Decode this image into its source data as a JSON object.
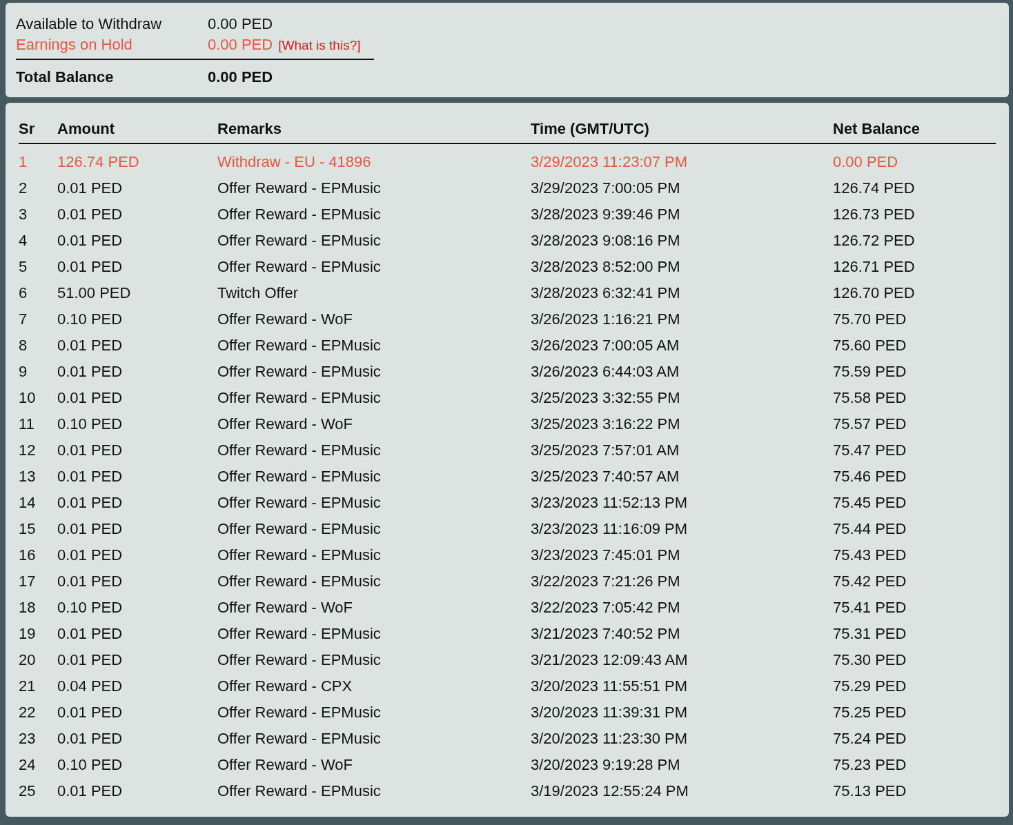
{
  "balance": {
    "rows": [
      {
        "kind": "available",
        "label": "Available to Withdraw",
        "value": "0.00 PED"
      },
      {
        "kind": "hold",
        "label": "Earnings on Hold",
        "value": "0.00 PED",
        "link": "[What is this?]"
      },
      {
        "kind": "total",
        "label": "Total Balance",
        "value": "0.00 PED"
      }
    ]
  },
  "table": {
    "columns": [
      "Sr",
      "Amount",
      "Remarks",
      "Time (GMT/UTC)",
      "Net Balance"
    ],
    "rows": [
      {
        "kind": "withdrawal",
        "cells": [
          "1",
          "126.74 PED",
          "Withdraw - EU - 41896",
          "3/29/2023 11:23:07 PM",
          "0.00 PED"
        ]
      },
      {
        "kind": "credit",
        "cells": [
          "2",
          "0.01 PED",
          "Offer Reward - EPMusic",
          "3/29/2023 7:00:05 PM",
          "126.74 PED"
        ]
      },
      {
        "kind": "credit",
        "cells": [
          "3",
          "0.01 PED",
          "Offer Reward - EPMusic",
          "3/28/2023 9:39:46 PM",
          "126.73 PED"
        ]
      },
      {
        "kind": "credit",
        "cells": [
          "4",
          "0.01 PED",
          "Offer Reward - EPMusic",
          "3/28/2023 9:08:16 PM",
          "126.72 PED"
        ]
      },
      {
        "kind": "credit",
        "cells": [
          "5",
          "0.01 PED",
          "Offer Reward - EPMusic",
          "3/28/2023 8:52:00 PM",
          "126.71 PED"
        ]
      },
      {
        "kind": "credit",
        "cells": [
          "6",
          "51.00 PED",
          "Twitch Offer",
          "3/28/2023 6:32:41 PM",
          "126.70 PED"
        ]
      },
      {
        "kind": "credit",
        "cells": [
          "7",
          "0.10 PED",
          "Offer Reward - WoF",
          "3/26/2023 1:16:21 PM",
          "75.70 PED"
        ]
      },
      {
        "kind": "credit",
        "cells": [
          "8",
          "0.01 PED",
          "Offer Reward - EPMusic",
          "3/26/2023 7:00:05 AM",
          "75.60 PED"
        ]
      },
      {
        "kind": "credit",
        "cells": [
          "9",
          "0.01 PED",
          "Offer Reward - EPMusic",
          "3/26/2023 6:44:03 AM",
          "75.59 PED"
        ]
      },
      {
        "kind": "credit",
        "cells": [
          "10",
          "0.01 PED",
          "Offer Reward - EPMusic",
          "3/25/2023 3:32:55 PM",
          "75.58 PED"
        ]
      },
      {
        "kind": "credit",
        "cells": [
          "11",
          "0.10 PED",
          "Offer Reward - WoF",
          "3/25/2023 3:16:22 PM",
          "75.57 PED"
        ]
      },
      {
        "kind": "credit",
        "cells": [
          "12",
          "0.01 PED",
          "Offer Reward - EPMusic",
          "3/25/2023 7:57:01 AM",
          "75.47 PED"
        ]
      },
      {
        "kind": "credit",
        "cells": [
          "13",
          "0.01 PED",
          "Offer Reward - EPMusic",
          "3/25/2023 7:40:57 AM",
          "75.46 PED"
        ]
      },
      {
        "kind": "credit",
        "cells": [
          "14",
          "0.01 PED",
          "Offer Reward - EPMusic",
          "3/23/2023 11:52:13 PM",
          "75.45 PED"
        ]
      },
      {
        "kind": "credit",
        "cells": [
          "15",
          "0.01 PED",
          "Offer Reward - EPMusic",
          "3/23/2023 11:16:09 PM",
          "75.44 PED"
        ]
      },
      {
        "kind": "credit",
        "cells": [
          "16",
          "0.01 PED",
          "Offer Reward - EPMusic",
          "3/23/2023 7:45:01 PM",
          "75.43 PED"
        ]
      },
      {
        "kind": "credit",
        "cells": [
          "17",
          "0.01 PED",
          "Offer Reward - EPMusic",
          "3/22/2023 7:21:26 PM",
          "75.42 PED"
        ]
      },
      {
        "kind": "credit",
        "cells": [
          "18",
          "0.10 PED",
          "Offer Reward - WoF",
          "3/22/2023 7:05:42 PM",
          "75.41 PED"
        ]
      },
      {
        "kind": "credit",
        "cells": [
          "19",
          "0.01 PED",
          "Offer Reward - EPMusic",
          "3/21/2023 7:40:52 PM",
          "75.31 PED"
        ]
      },
      {
        "kind": "credit",
        "cells": [
          "20",
          "0.01 PED",
          "Offer Reward - EPMusic",
          "3/21/2023 12:09:43 AM",
          "75.30 PED"
        ]
      },
      {
        "kind": "credit",
        "cells": [
          "21",
          "0.04 PED",
          "Offer Reward - CPX",
          "3/20/2023 11:55:51 PM",
          "75.29 PED"
        ]
      },
      {
        "kind": "credit",
        "cells": [
          "22",
          "0.01 PED",
          "Offer Reward - EPMusic",
          "3/20/2023 11:39:31 PM",
          "75.25 PED"
        ]
      },
      {
        "kind": "credit",
        "cells": [
          "23",
          "0.01 PED",
          "Offer Reward - EPMusic",
          "3/20/2023 11:23:30 PM",
          "75.24 PED"
        ]
      },
      {
        "kind": "credit",
        "cells": [
          "24",
          "0.10 PED",
          "Offer Reward - WoF",
          "3/20/2023 9:19:28 PM",
          "75.23 PED"
        ]
      },
      {
        "kind": "credit",
        "cells": [
          "25",
          "0.01 PED",
          "Offer Reward - EPMusic",
          "3/19/2023 12:55:24 PM",
          "75.13 PED"
        ]
      }
    ]
  }
}
